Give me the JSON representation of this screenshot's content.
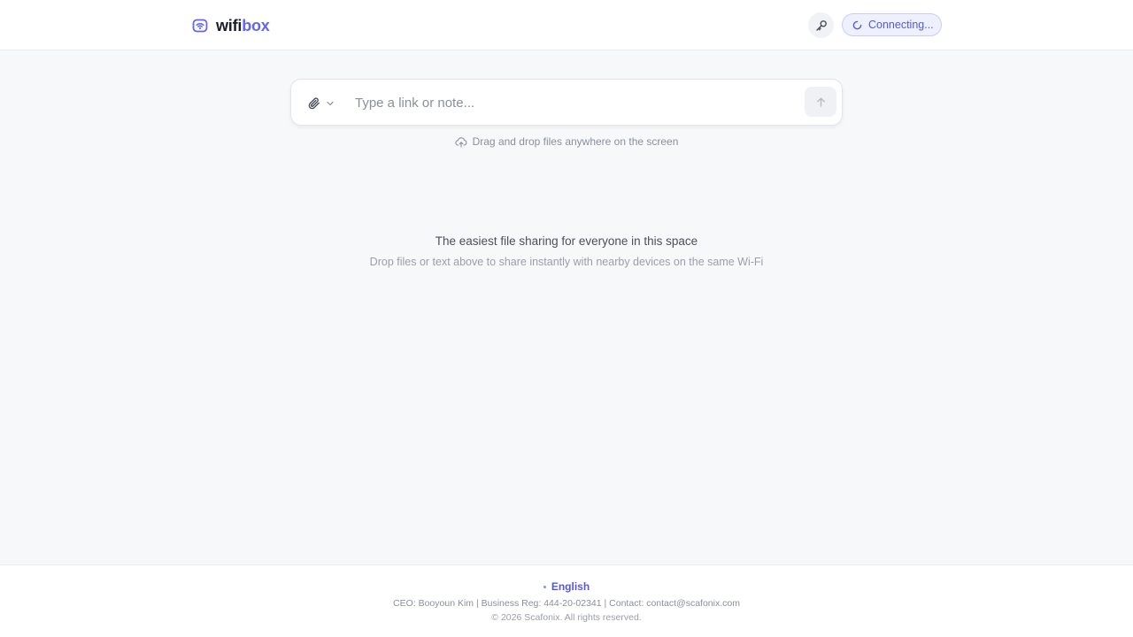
{
  "header": {
    "brand_wifi": "wifi",
    "brand_box": "box",
    "status_text": "Connecting...",
    "icons": {
      "brand": "wifi-box-icon",
      "key": "key-icon",
      "status": "loading-spinner-icon"
    }
  },
  "composer": {
    "placeholder": "Type a link or note...",
    "value": "",
    "icons": {
      "attach": "paperclip-icon",
      "dropdown": "chevron-down-icon",
      "send": "arrow-up-icon"
    }
  },
  "dnd_hint": {
    "text": "Drag and drop files anywhere on the screen",
    "icon": "cloud-upload-icon"
  },
  "main": {
    "headline": "The easiest file sharing for everyone in this space",
    "subline": "Drop files or text above to share instantly with nearby devices on the same Wi-Fi"
  },
  "footer": {
    "language": "English",
    "business_info": "CEO: Booyoun Kim | Business Reg: 444-20-02341 | Contact: contact@scafonix.com",
    "copyright": "© 2026 Scafonix. All rights reserved."
  },
  "colors": {
    "accent": "#6366f1",
    "background": "#f7f8fa",
    "surface": "#ffffff",
    "status_bg": "#eef0fd"
  }
}
